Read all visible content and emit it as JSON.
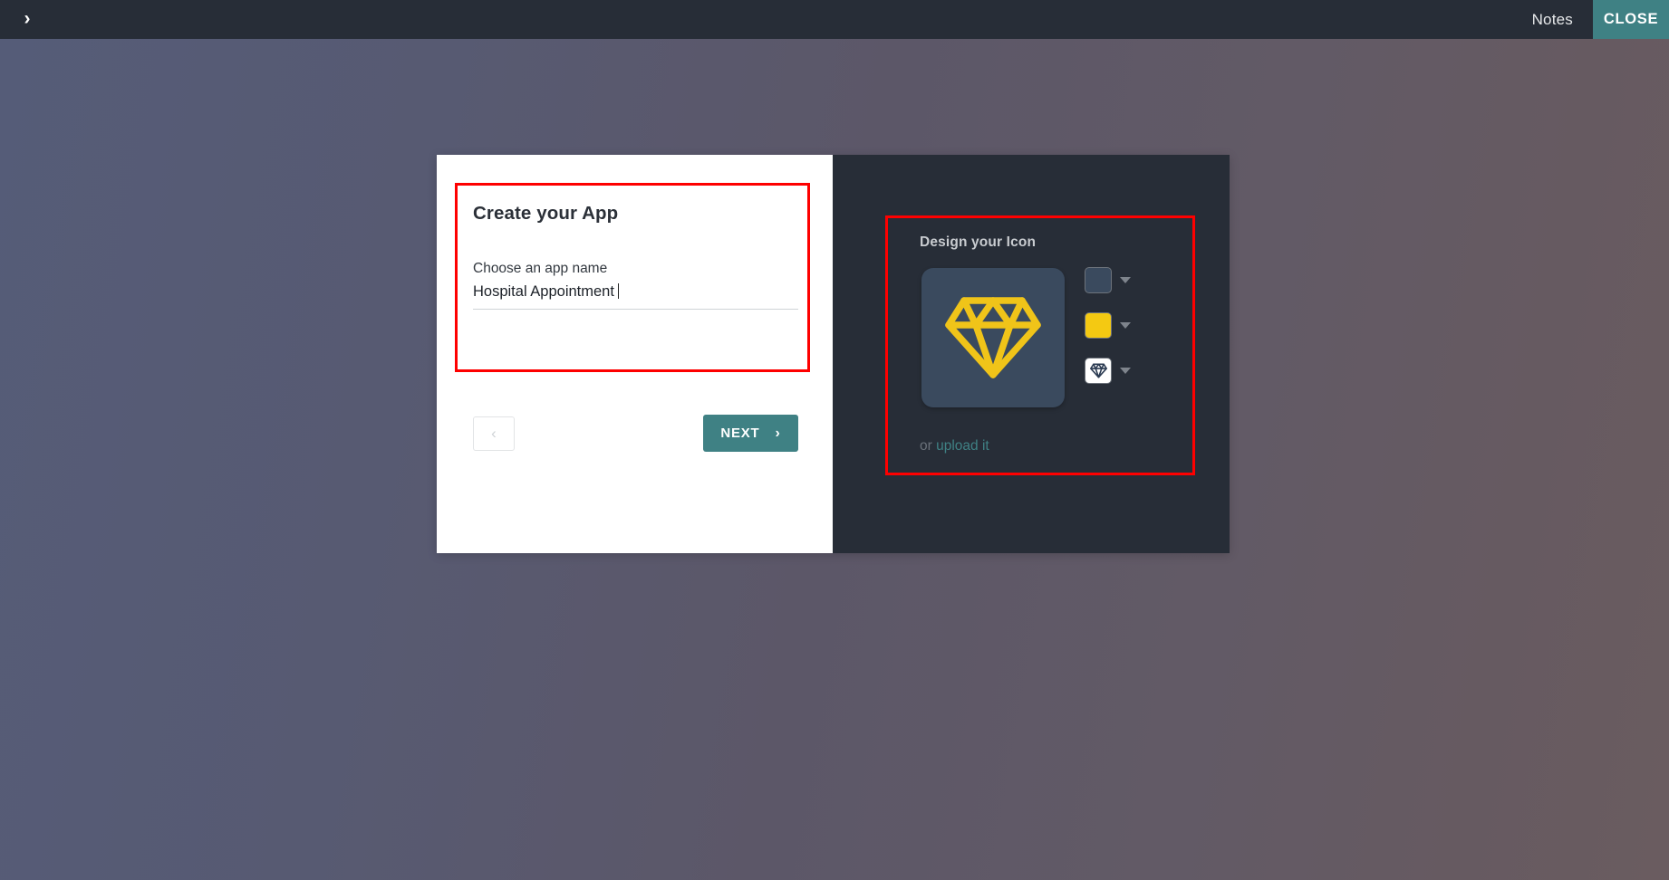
{
  "topbar": {
    "expand_icon": "chevron-right-icon",
    "notes_label": "Notes",
    "close_label": "CLOSE",
    "bg_color": "#272d37",
    "close_color": "#3f8184"
  },
  "dialog": {
    "left_panel": {
      "title": "Create your App",
      "field_label": "Choose an app name",
      "field_value": "Hospital Appointment",
      "field_placeholder": "Choose an app name",
      "back_icon": "chevron-left-icon",
      "next_label": "NEXT",
      "next_icon": "chevron-right-icon"
    },
    "right_panel": {
      "title": "Design your Icon",
      "preview_icon": "diamond-icon",
      "preview_bg_color": "#3a4a5e",
      "preview_icon_color": "#f0c419",
      "swatches": [
        {
          "name": "background-color-swatch",
          "color": "#3a4a5e",
          "type": "color"
        },
        {
          "name": "icon-color-swatch",
          "color": "#f4c912",
          "type": "color"
        },
        {
          "name": "icon-shape-swatch",
          "color": "#ffffff",
          "type": "glyph",
          "glyph": "diamond-icon"
        }
      ],
      "upload_prefix": "or ",
      "upload_link": "upload it"
    }
  },
  "annotations": {
    "left_box_color": "#fe0000",
    "right_box_color": "#fe0000"
  }
}
